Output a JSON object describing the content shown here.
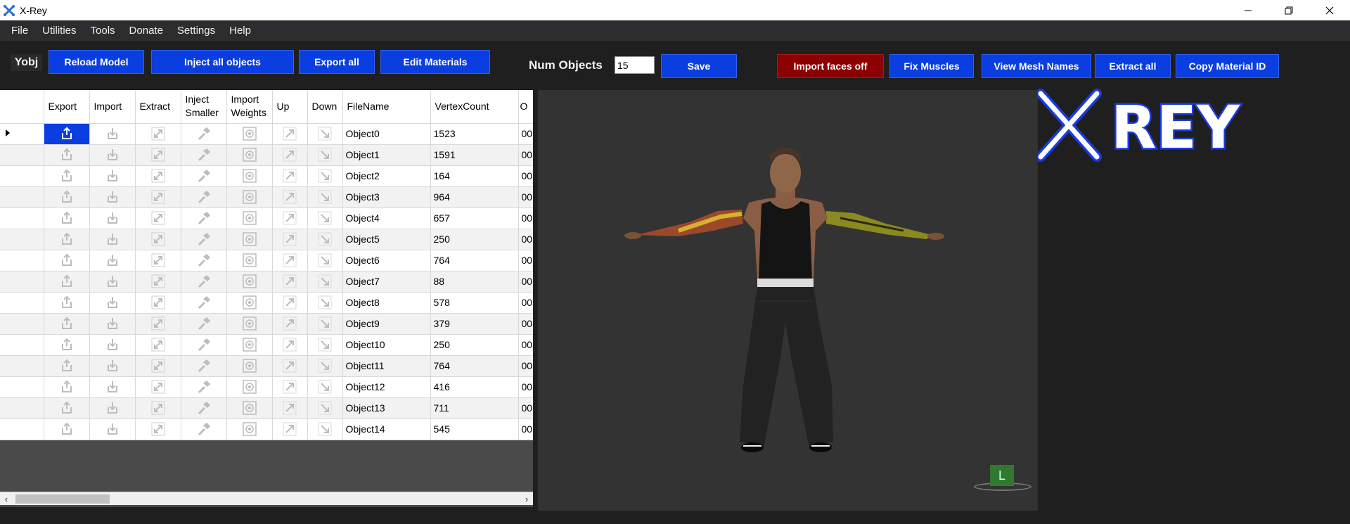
{
  "window": {
    "title": "X-Rey"
  },
  "menu": [
    "File",
    "Utilities",
    "Tools",
    "Donate",
    "Settings",
    "Help"
  ],
  "toolbar": {
    "mode_label": "Yobj",
    "reload": "Reload Model",
    "inject_all": "Inject all objects",
    "export_all": "Export all",
    "edit_materials": "Edit Materials",
    "num_objects_label": "Num Objects",
    "num_objects_value": "15",
    "save": "Save",
    "import_faces": "Import faces off",
    "fix_muscles": "Fix Muscles",
    "view_mesh_names": "View Mesh Names",
    "extract_all": "Extract all",
    "copy_material_id": "Copy Material ID"
  },
  "logo_text": "X REY",
  "grid": {
    "columns": [
      "Export",
      "Import",
      "Extract",
      "Inject Smaller",
      "Import Weights",
      "Up",
      "Down",
      "FileName",
      "VertexCount",
      "O"
    ],
    "rows": [
      {
        "name": "Object0",
        "count": "1523",
        "o": "00"
      },
      {
        "name": "Object1",
        "count": "1591",
        "o": "00"
      },
      {
        "name": "Object2",
        "count": "164",
        "o": "00"
      },
      {
        "name": "Object3",
        "count": "964",
        "o": "00"
      },
      {
        "name": "Object4",
        "count": "657",
        "o": "00"
      },
      {
        "name": "Object5",
        "count": "250",
        "o": "00"
      },
      {
        "name": "Object6",
        "count": "764",
        "o": "00"
      },
      {
        "name": "Object7",
        "count": "88",
        "o": "00"
      },
      {
        "name": "Object8",
        "count": "578",
        "o": "00"
      },
      {
        "name": "Object9",
        "count": "379",
        "o": "00"
      },
      {
        "name": "Object10",
        "count": "250",
        "o": "00"
      },
      {
        "name": "Object11",
        "count": "764",
        "o": "00"
      },
      {
        "name": "Object12",
        "count": "416",
        "o": "00"
      },
      {
        "name": "Object13",
        "count": "711",
        "o": "00"
      },
      {
        "name": "Object14",
        "count": "545",
        "o": "00"
      }
    ],
    "selected_row": 0
  },
  "viewport": {
    "badge": "L"
  },
  "colors": {
    "button_blue": "#0a3ee0",
    "button_red": "#8b0000",
    "bg": "#1f1f1f"
  }
}
